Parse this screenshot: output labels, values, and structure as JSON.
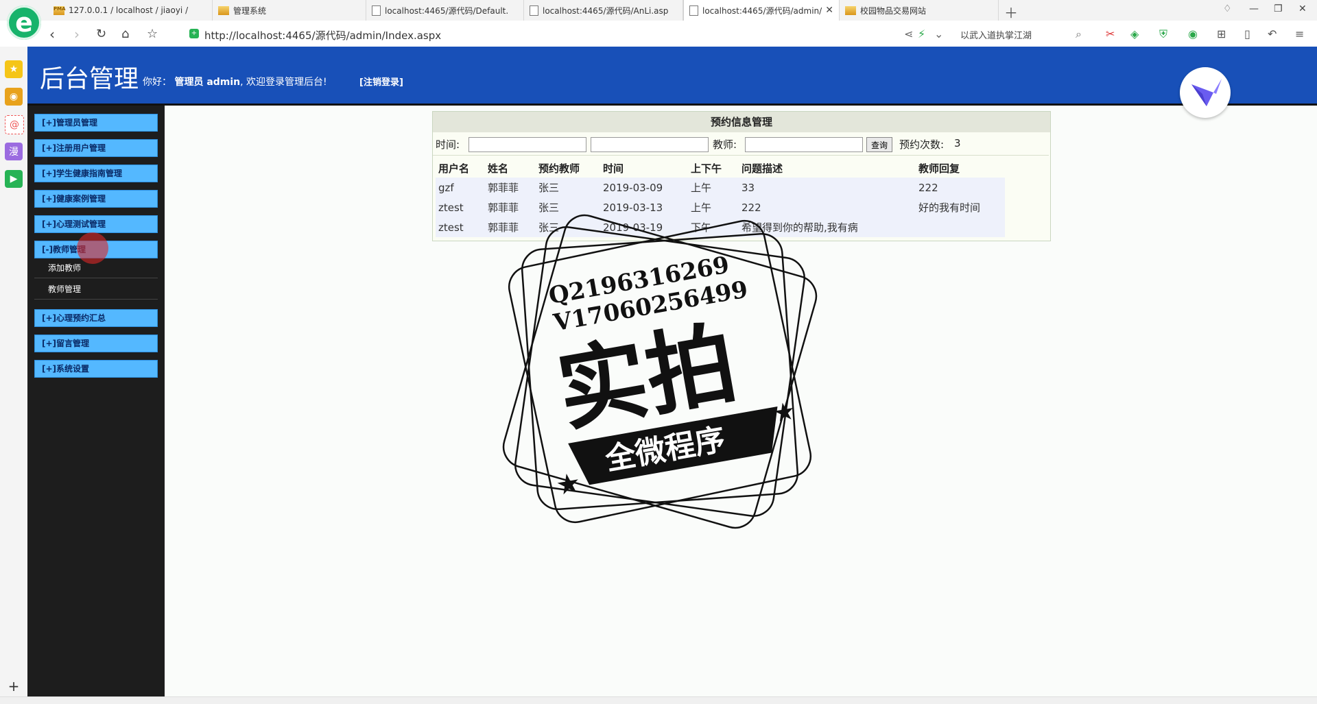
{
  "browser": {
    "tabs": [
      {
        "label": "127.0.0.1 / localhost / jiaoyi /",
        "icon": "phpmyadmin-icon"
      },
      {
        "label": "管理系统",
        "icon": "chart-icon"
      },
      {
        "label": "localhost:4465/源代码/Default.",
        "icon": "page-icon"
      },
      {
        "label": "localhost:4465/源代码/AnLi.asp",
        "icon": "page-icon"
      },
      {
        "label": "localhost:4465/源代码/admin/",
        "icon": "page-icon"
      },
      {
        "label": "校园物品交易网站",
        "icon": "chart-icon"
      }
    ],
    "url": "http://localhost:4465/源代码/admin/Index.aspx",
    "search_text": "以武入道执掌江湖"
  },
  "header": {
    "title": "后台管理",
    "greeting_prefix": "你好：",
    "user": "管理员 admin",
    "greeting_suffix": ", 欢迎登录管理后台!",
    "logout": "[注销登录]"
  },
  "sidebar": {
    "items": [
      {
        "label": "[+]管理员管理"
      },
      {
        "label": "[+]注册用户管理"
      },
      {
        "label": "[+]学生健康指南管理"
      },
      {
        "label": "[+]健康案例管理"
      },
      {
        "label": "[+]心理测试管理"
      },
      {
        "label": "[-]教师管理"
      },
      {
        "label": "[+]心理预约汇总"
      },
      {
        "label": "[+]留言管理"
      },
      {
        "label": "[+]系统设置"
      }
    ],
    "subitems": [
      {
        "label": "添加教师"
      },
      {
        "label": "教师管理"
      }
    ]
  },
  "panel": {
    "title": "预约信息管理",
    "time_label": "时间:",
    "teacher_label": "教师:",
    "query_button": "查询",
    "count_label": "预约次数:",
    "count_value": "3",
    "columns": [
      "用户名",
      "姓名",
      "预约教师",
      "时间",
      "上下午",
      "问题描述",
      "教师回复"
    ],
    "rows": [
      [
        "gzf",
        "郭菲菲",
        "张三",
        "2019-03-09",
        "上午",
        "33",
        "222"
      ],
      [
        "ztest",
        "郭菲菲",
        "张三",
        "2019-03-13",
        "上午",
        "222",
        "好的我有时间"
      ],
      [
        "ztest",
        "郭菲菲",
        "张三",
        "2019-03-19",
        "下午",
        "希望得到你的帮助,我有病",
        ""
      ]
    ]
  },
  "watermark": {
    "line1": "Q2196316269",
    "line2": "V17060256499",
    "big": "实拍",
    "banner": "全微程序"
  },
  "colors": {
    "header": "#1850b8",
    "menu": "#54b8ff",
    "sidebar": "#1d1d1d"
  }
}
